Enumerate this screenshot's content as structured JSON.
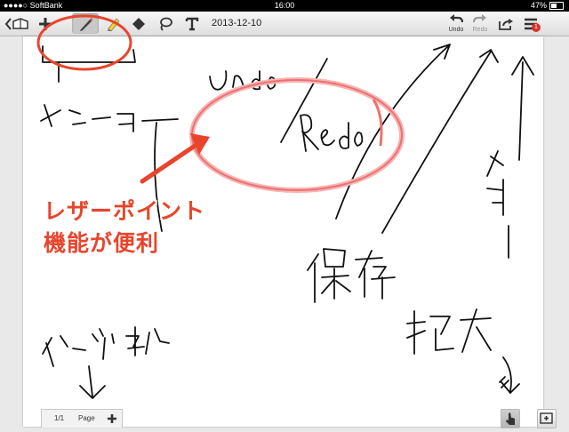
{
  "statusbar": {
    "carrier": "●●●●○ SoftBank",
    "time": "16:00",
    "battery": "47%"
  },
  "toolbar": {
    "date": "2013-12-10",
    "undo_label": "Undo",
    "redo_label": "Redo",
    "badge_count": "1"
  },
  "overlay": {
    "line1": "レザーポイント",
    "line2": "機能が便利"
  },
  "pagebar": {
    "page_counter": "1/1",
    "page_label": "Page"
  },
  "colors": {
    "highlight_red": "#e8452c",
    "laser_pink": "#f08080",
    "selected_pen": "#2a8fd6"
  }
}
